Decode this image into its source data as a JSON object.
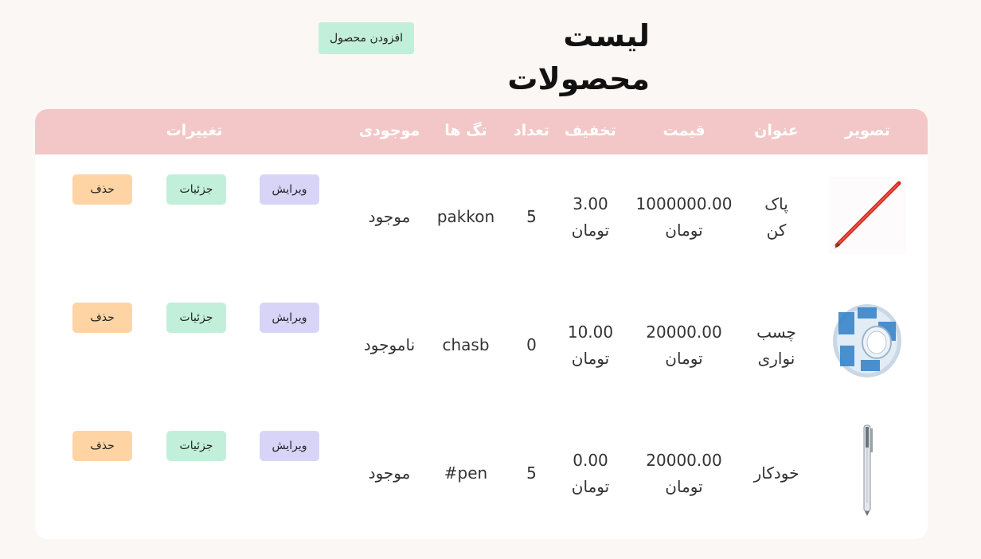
{
  "header": {
    "title": "لیست محصولات",
    "add_button": "افزودن محصول"
  },
  "table": {
    "columns": {
      "image": "تصویر",
      "title": "عنوان",
      "price": "قیمت",
      "discount": "تخفیف",
      "count": "تعداد",
      "tags": "تگ ها",
      "stock": "موجودی",
      "actions": "تغییرات"
    },
    "rows": [
      {
        "image": "red-pencil",
        "title_line1": "پاک",
        "title_line2": "کن",
        "price": "1000000.00",
        "price_unit": "تومان",
        "discount": "3.00",
        "discount_unit": "تومان",
        "count": "5",
        "tags": "pakkon",
        "stock": "موجود",
        "edit": "ویرایش",
        "details": "جزئیات",
        "delete": "حذف"
      },
      {
        "image": "packing-tape",
        "title_line1": "چسب",
        "title_line2": "نواری",
        "price": "20000.00",
        "price_unit": "تومان",
        "discount": "10.00",
        "discount_unit": "تومان",
        "count": "0",
        "tags": "chasb",
        "stock": "ناموجود",
        "edit": "ویرایش",
        "details": "جزئیات",
        "delete": "حذف"
      },
      {
        "image": "ballpoint-pen",
        "title_line1": "خودکار",
        "title_line2": "",
        "price": "20000.00",
        "price_unit": "تومان",
        "discount": "0.00",
        "discount_unit": "تومان",
        "count": "5",
        "tags": "#pen",
        "stock": "موجود",
        "edit": "ویرایش",
        "details": "جزئیات",
        "delete": "حذف"
      }
    ]
  },
  "colors": {
    "background": "#fbf7f4",
    "table_header": "#f3c7c7",
    "add_button": "#c2efd9",
    "edit_button": "#d8d4f8",
    "details_button": "#c2efd9",
    "delete_button": "#ffd4a4"
  }
}
